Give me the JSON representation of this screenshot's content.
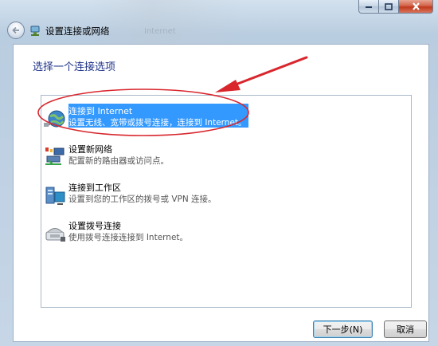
{
  "window": {
    "title": "设置连接或网络",
    "caption_buttons": {
      "minimize_icon": "minimize-icon",
      "maximize_icon": "maximize-icon",
      "close_icon": "close-icon"
    }
  },
  "nav": {
    "back_icon": "back-arrow-icon",
    "title_icon": "network-setup-icon",
    "background_text": [
      "Internet"
    ]
  },
  "content": {
    "heading": "选择一个连接选项",
    "options": [
      {
        "title": "连接到 Internet",
        "description": "设置无线、宽带或拨号连接，连接到 Internet。",
        "icon": "globe-network-icon",
        "selected": true
      },
      {
        "title": "设置新网络",
        "description": "配置新的路由器或访问点。",
        "icon": "router-icon",
        "selected": false
      },
      {
        "title": "连接到工作区",
        "description": "设置到您的工作区的拨号或 VPN 连接。",
        "icon": "workplace-vpn-icon",
        "selected": false
      },
      {
        "title": "设置拨号连接",
        "description": "使用拨号连接连接到 Internet。",
        "icon": "dialup-phone-icon",
        "selected": false
      }
    ],
    "annotation": {
      "color": "#d9262d",
      "shapes": [
        "ellipse",
        "arrow"
      ]
    }
  },
  "buttons": {
    "next": "下一步(N)",
    "cancel": "取消"
  },
  "colors": {
    "selection": "#3399ff",
    "heading": "#1e3287",
    "annotation": "#d9262d"
  }
}
